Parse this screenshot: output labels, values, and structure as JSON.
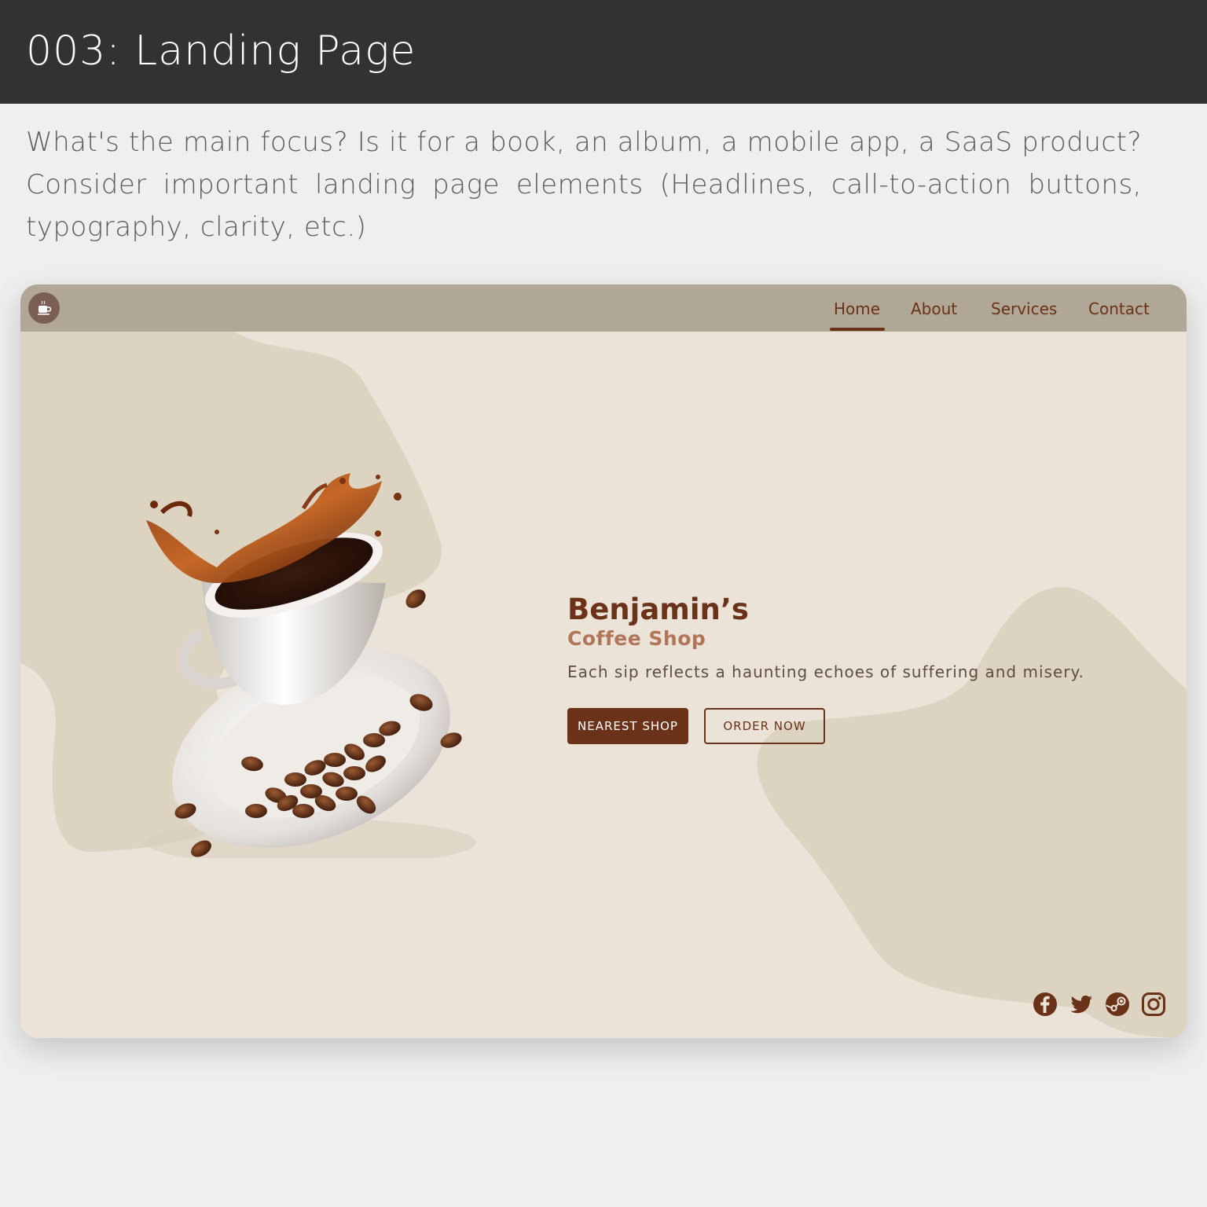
{
  "header": {
    "title": "003: Landing Page"
  },
  "prompt": "What's the main focus? Is it for a book, an album, a mobile app, a SaaS product? Consider important landing page elements (Headlines, call-to-action buttons, typography, clarity, etc.)",
  "site": {
    "nav": {
      "items": [
        {
          "label": "Home",
          "active": true
        },
        {
          "label": "About",
          "active": false
        },
        {
          "label": "Services",
          "active": false
        },
        {
          "label": "Contact",
          "active": false
        }
      ]
    },
    "hero": {
      "brand": "Benjamin’s",
      "subtitle": "Coffee Shop",
      "tagline": "Each sip reflects a haunting echoes of suffering and misery.",
      "primary_button": "NEAREST SHOP",
      "secondary_button": "ORDER NOW"
    },
    "socials": [
      "facebook-icon",
      "twitter-icon",
      "steam-icon",
      "instagram-icon"
    ]
  },
  "colors": {
    "header_bg": "#323232",
    "page_bg": "#efefef",
    "card_bg": "#ebe3d7",
    "blob": "#dcd3c0",
    "nav_bg": "#b0a796",
    "brand_brown": "#6a3218",
    "accent_tan": "#b07657"
  }
}
